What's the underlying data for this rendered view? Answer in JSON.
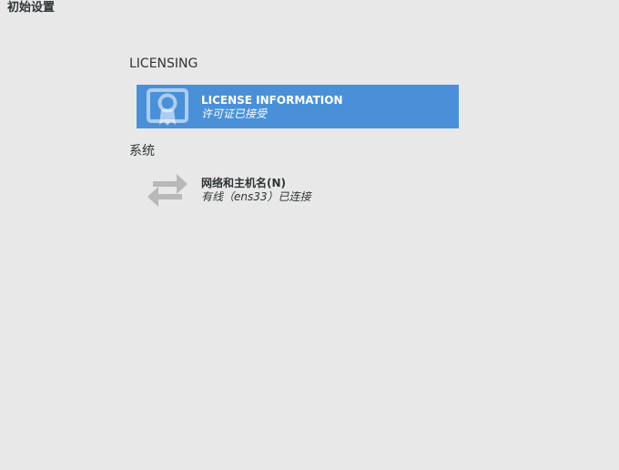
{
  "window": {
    "title": "初始设置"
  },
  "sections": {
    "licensing": {
      "title": "LICENSING",
      "spoke": {
        "name": "LICENSE INFORMATION",
        "status": "许可证已接受",
        "icon": "license-certificate-icon"
      }
    },
    "system": {
      "title": "系统",
      "spoke": {
        "name": "网络和主机名(N)",
        "status": "有线（ens33）已连接",
        "icon": "network-arrows-icon"
      }
    }
  },
  "colors": {
    "background": "#e8e8e8",
    "selected": "#4a90d9",
    "icon_gray": "#b8b8b8"
  }
}
